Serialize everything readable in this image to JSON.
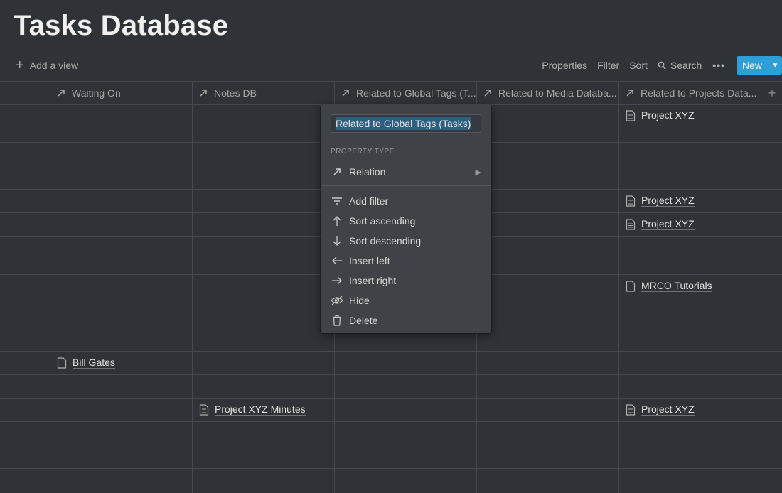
{
  "page": {
    "title": "Tasks Database"
  },
  "toolbar": {
    "add_view": "Add a view",
    "properties": "Properties",
    "filter": "Filter",
    "sort": "Sort",
    "search": "Search",
    "more": "•••",
    "new": "New"
  },
  "columns": [
    "Waiting On",
    "Notes DB",
    "Related to Global Tags (T...",
    "Related to Media Databa...",
    "Related to Projects Data..."
  ],
  "cells": {
    "r1_projects": "Project XYZ",
    "r4_projects": "Project XYZ",
    "r5_projects": "Project XYZ",
    "r7_projects": "MRCO Tutorials",
    "r9_waiting": "Bill Gates",
    "r11_notes": "Project XYZ Minutes",
    "r11_projects": "Project XYZ"
  },
  "menu": {
    "input_value": "Related to Global Tags (Tasks)",
    "section_label": "PROPERTY TYPE",
    "type": "Relation",
    "items": [
      "Add filter",
      "Sort ascending",
      "Sort descending",
      "Insert left",
      "Insert right",
      "Hide",
      "Delete"
    ]
  }
}
